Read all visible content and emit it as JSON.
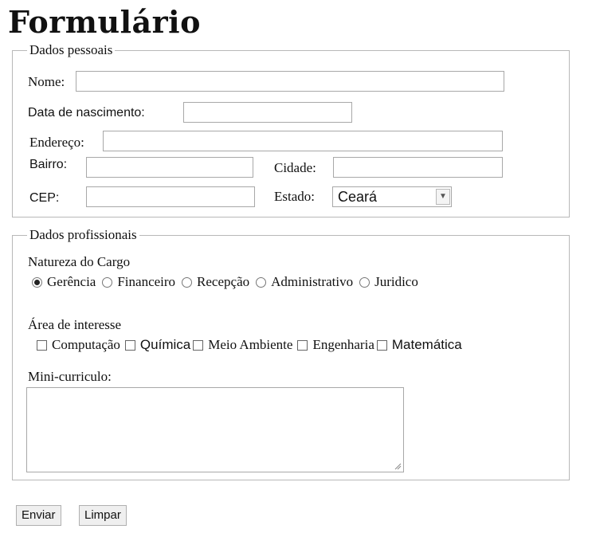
{
  "page": {
    "title": "Formulário"
  },
  "personal": {
    "legend": "Dados pessoais",
    "nome_label": "Nome:",
    "nome_value": "",
    "nascimento_label": "Data de nascimento:",
    "nascimento_value": "",
    "endereco_label": "Endereço:",
    "endereco_value": "",
    "bairro_label": "Bairro:",
    "bairro_value": "",
    "cidade_label": "Cidade:",
    "cidade_value": "",
    "cep_label": "CEP:",
    "cep_value": "",
    "estado_label": "Estado:",
    "estado_value": "Ceará"
  },
  "professional": {
    "legend": "Dados profissionais",
    "natureza_label": "Natureza do Cargo",
    "natureza_options": [
      {
        "label": "Gerência",
        "checked": true
      },
      {
        "label": "Financeiro",
        "checked": false
      },
      {
        "label": "Recepção",
        "checked": false
      },
      {
        "label": "Administrativo",
        "checked": false
      },
      {
        "label": "Juridico",
        "checked": false
      }
    ],
    "area_label": "Área de interesse",
    "area_options": [
      {
        "label": "Computação",
        "checked": false
      },
      {
        "label": "Química",
        "checked": false
      },
      {
        "label": "Meio Ambiente",
        "checked": false
      },
      {
        "label": "Engenharia",
        "checked": false
      },
      {
        "label": "Matemática",
        "checked": false
      }
    ],
    "curriculo_label": "Mini-curriculo:",
    "curriculo_value": ""
  },
  "actions": {
    "submit_label": "Enviar",
    "reset_label": "Limpar"
  }
}
